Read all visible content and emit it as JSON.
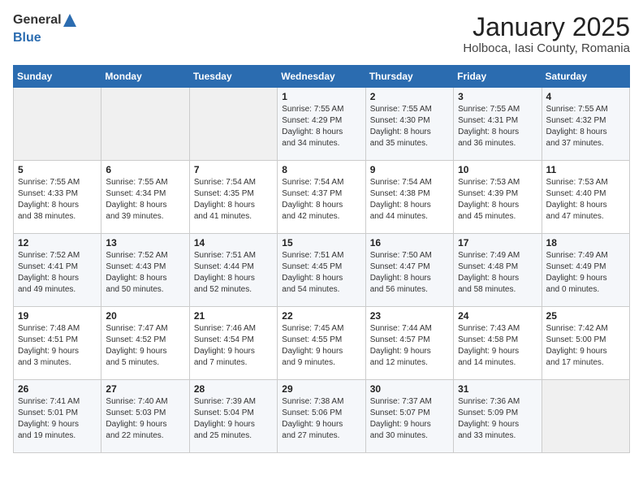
{
  "header": {
    "logo_general": "General",
    "logo_blue": "Blue",
    "title": "January 2025",
    "subtitle": "Holboca, Iasi County, Romania"
  },
  "weekdays": [
    "Sunday",
    "Monday",
    "Tuesday",
    "Wednesday",
    "Thursday",
    "Friday",
    "Saturday"
  ],
  "weeks": [
    [
      {
        "day": "",
        "info": ""
      },
      {
        "day": "",
        "info": ""
      },
      {
        "day": "",
        "info": ""
      },
      {
        "day": "1",
        "info": "Sunrise: 7:55 AM\nSunset: 4:29 PM\nDaylight: 8 hours\nand 34 minutes."
      },
      {
        "day": "2",
        "info": "Sunrise: 7:55 AM\nSunset: 4:30 PM\nDaylight: 8 hours\nand 35 minutes."
      },
      {
        "day": "3",
        "info": "Sunrise: 7:55 AM\nSunset: 4:31 PM\nDaylight: 8 hours\nand 36 minutes."
      },
      {
        "day": "4",
        "info": "Sunrise: 7:55 AM\nSunset: 4:32 PM\nDaylight: 8 hours\nand 37 minutes."
      }
    ],
    [
      {
        "day": "5",
        "info": "Sunrise: 7:55 AM\nSunset: 4:33 PM\nDaylight: 8 hours\nand 38 minutes."
      },
      {
        "day": "6",
        "info": "Sunrise: 7:55 AM\nSunset: 4:34 PM\nDaylight: 8 hours\nand 39 minutes."
      },
      {
        "day": "7",
        "info": "Sunrise: 7:54 AM\nSunset: 4:35 PM\nDaylight: 8 hours\nand 41 minutes."
      },
      {
        "day": "8",
        "info": "Sunrise: 7:54 AM\nSunset: 4:37 PM\nDaylight: 8 hours\nand 42 minutes."
      },
      {
        "day": "9",
        "info": "Sunrise: 7:54 AM\nSunset: 4:38 PM\nDaylight: 8 hours\nand 44 minutes."
      },
      {
        "day": "10",
        "info": "Sunrise: 7:53 AM\nSunset: 4:39 PM\nDaylight: 8 hours\nand 45 minutes."
      },
      {
        "day": "11",
        "info": "Sunrise: 7:53 AM\nSunset: 4:40 PM\nDaylight: 8 hours\nand 47 minutes."
      }
    ],
    [
      {
        "day": "12",
        "info": "Sunrise: 7:52 AM\nSunset: 4:41 PM\nDaylight: 8 hours\nand 49 minutes."
      },
      {
        "day": "13",
        "info": "Sunrise: 7:52 AM\nSunset: 4:43 PM\nDaylight: 8 hours\nand 50 minutes."
      },
      {
        "day": "14",
        "info": "Sunrise: 7:51 AM\nSunset: 4:44 PM\nDaylight: 8 hours\nand 52 minutes."
      },
      {
        "day": "15",
        "info": "Sunrise: 7:51 AM\nSunset: 4:45 PM\nDaylight: 8 hours\nand 54 minutes."
      },
      {
        "day": "16",
        "info": "Sunrise: 7:50 AM\nSunset: 4:47 PM\nDaylight: 8 hours\nand 56 minutes."
      },
      {
        "day": "17",
        "info": "Sunrise: 7:49 AM\nSunset: 4:48 PM\nDaylight: 8 hours\nand 58 minutes."
      },
      {
        "day": "18",
        "info": "Sunrise: 7:49 AM\nSunset: 4:49 PM\nDaylight: 9 hours\nand 0 minutes."
      }
    ],
    [
      {
        "day": "19",
        "info": "Sunrise: 7:48 AM\nSunset: 4:51 PM\nDaylight: 9 hours\nand 3 minutes."
      },
      {
        "day": "20",
        "info": "Sunrise: 7:47 AM\nSunset: 4:52 PM\nDaylight: 9 hours\nand 5 minutes."
      },
      {
        "day": "21",
        "info": "Sunrise: 7:46 AM\nSunset: 4:54 PM\nDaylight: 9 hours\nand 7 minutes."
      },
      {
        "day": "22",
        "info": "Sunrise: 7:45 AM\nSunset: 4:55 PM\nDaylight: 9 hours\nand 9 minutes."
      },
      {
        "day": "23",
        "info": "Sunrise: 7:44 AM\nSunset: 4:57 PM\nDaylight: 9 hours\nand 12 minutes."
      },
      {
        "day": "24",
        "info": "Sunrise: 7:43 AM\nSunset: 4:58 PM\nDaylight: 9 hours\nand 14 minutes."
      },
      {
        "day": "25",
        "info": "Sunrise: 7:42 AM\nSunset: 5:00 PM\nDaylight: 9 hours\nand 17 minutes."
      }
    ],
    [
      {
        "day": "26",
        "info": "Sunrise: 7:41 AM\nSunset: 5:01 PM\nDaylight: 9 hours\nand 19 minutes."
      },
      {
        "day": "27",
        "info": "Sunrise: 7:40 AM\nSunset: 5:03 PM\nDaylight: 9 hours\nand 22 minutes."
      },
      {
        "day": "28",
        "info": "Sunrise: 7:39 AM\nSunset: 5:04 PM\nDaylight: 9 hours\nand 25 minutes."
      },
      {
        "day": "29",
        "info": "Sunrise: 7:38 AM\nSunset: 5:06 PM\nDaylight: 9 hours\nand 27 minutes."
      },
      {
        "day": "30",
        "info": "Sunrise: 7:37 AM\nSunset: 5:07 PM\nDaylight: 9 hours\nand 30 minutes."
      },
      {
        "day": "31",
        "info": "Sunrise: 7:36 AM\nSunset: 5:09 PM\nDaylight: 9 hours\nand 33 minutes."
      },
      {
        "day": "",
        "info": ""
      }
    ]
  ]
}
